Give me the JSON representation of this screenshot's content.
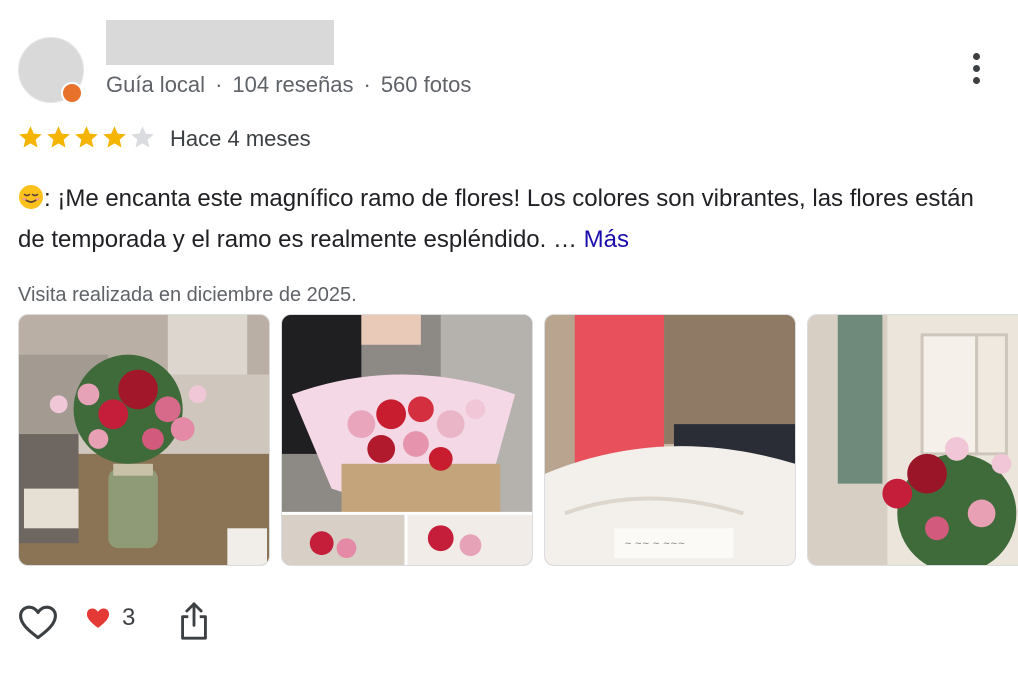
{
  "reviewer": {
    "avatar_icon": "user-avatar-icon",
    "meta": {
      "role": "Guía local",
      "separator": "·",
      "reviews": "104 reseñas",
      "photos": "560 fotos"
    }
  },
  "menu": {
    "icon": "more-vertical-icon"
  },
  "rating": {
    "value": 4,
    "max": 5,
    "filled_color": "#f4b400",
    "empty_color": "#dadce0"
  },
  "time_ago": "Hace 4 meses",
  "review": {
    "emoji_icon": "relieved-face-emoji",
    "text": ": ¡Me encanta este magnífico ramo de flores! Los colores son vibrantes, las flores están de temporada y el ramo es realmente espléndido. … ",
    "more_label": "Más"
  },
  "visit": "Visita realizada en diciembre de 2025.",
  "photos": [
    {
      "icon": "bouquet-vase-photo"
    },
    {
      "icon": "bouquet-hand-photo"
    },
    {
      "icon": "bedroom-card-photo"
    },
    {
      "icon": "bouquet-window-photo"
    }
  ],
  "actions": {
    "like_icon": "heart-outline-icon",
    "reaction_icon": "red-heart-icon",
    "reaction_count": "3",
    "share_icon": "share-icon"
  },
  "colors": {
    "link": "#1a0dab",
    "meta_text": "#5f6368",
    "heart": "#e53935"
  }
}
